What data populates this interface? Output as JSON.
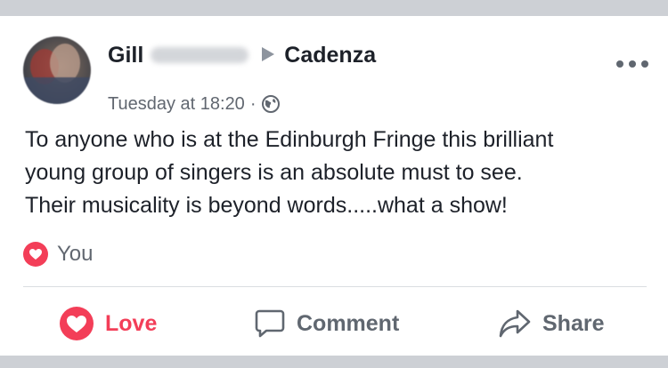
{
  "post": {
    "author_first_name": "Gill",
    "target_group": "Cadenza",
    "timestamp": "Tuesday at 18:20",
    "separator": "·",
    "privacy_icon": "globe-icon",
    "text_lines": [
      "To anyone who is at the Edinburgh Fringe this brilliant",
      "young group of singers is an absolute must to see.",
      "Their musicality is beyond words.....what a show!"
    ]
  },
  "reactions": {
    "icon": "heart-icon",
    "label": "You",
    "color": "#f33e58"
  },
  "actions": {
    "love_label": "Love",
    "comment_label": "Comment",
    "share_label": "Share"
  },
  "colors": {
    "text_primary": "#1d2129",
    "text_secondary": "#616770",
    "love_red": "#f33e58",
    "background": "#cdd0d5"
  }
}
